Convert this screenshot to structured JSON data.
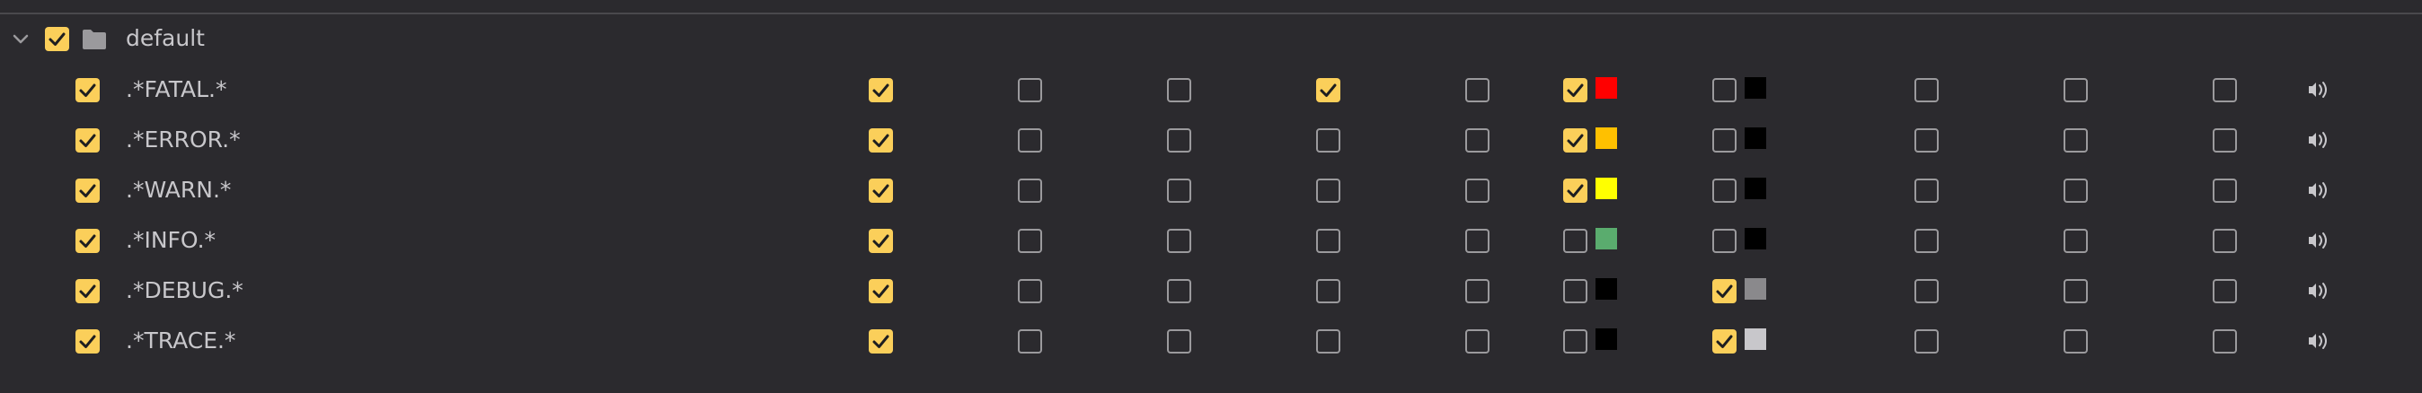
{
  "group": {
    "label": "default",
    "checked": true,
    "expanded": true
  },
  "rows": [
    {
      "label": ".*FATAL.*",
      "enabled": true,
      "checks": [
        true,
        false,
        false,
        true,
        false
      ],
      "fg": {
        "checked": true,
        "color": "#ff0000"
      },
      "bg": {
        "checked": false,
        "color": "#000000"
      },
      "tail": [
        false,
        false,
        false
      ]
    },
    {
      "label": ".*ERROR.*",
      "enabled": true,
      "checks": [
        true,
        false,
        false,
        false,
        false
      ],
      "fg": {
        "checked": true,
        "color": "#ffc000"
      },
      "bg": {
        "checked": false,
        "color": "#000000"
      },
      "tail": [
        false,
        false,
        false
      ]
    },
    {
      "label": ".*WARN.*",
      "enabled": true,
      "checks": [
        true,
        false,
        false,
        false,
        false
      ],
      "fg": {
        "checked": true,
        "color": "#ffff00"
      },
      "bg": {
        "checked": false,
        "color": "#000000"
      },
      "tail": [
        false,
        false,
        false
      ]
    },
    {
      "label": ".*INFO.*",
      "enabled": true,
      "checks": [
        true,
        false,
        false,
        false,
        false
      ],
      "fg": {
        "checked": false,
        "color": "#5aac6e"
      },
      "bg": {
        "checked": false,
        "color": "#000000"
      },
      "tail": [
        false,
        false,
        false
      ]
    },
    {
      "label": ".*DEBUG.*",
      "enabled": true,
      "checks": [
        true,
        false,
        false,
        false,
        false
      ],
      "fg": {
        "checked": false,
        "color": "#000000"
      },
      "bg": {
        "checked": true,
        "color": "#8a898c"
      },
      "tail": [
        false,
        false,
        false
      ]
    },
    {
      "label": ".*TRACE.*",
      "enabled": true,
      "checks": [
        true,
        false,
        false,
        false,
        false
      ],
      "fg": {
        "checked": false,
        "color": "#000000"
      },
      "bg": {
        "checked": true,
        "color": "#c8c7cb"
      },
      "tail": [
        false,
        false,
        false
      ]
    }
  ],
  "icons": {
    "expand": "chevron-down-icon",
    "folder": "folder-icon",
    "sound": "speaker-icon"
  },
  "colors": {
    "background": "#2b2a2e",
    "checkbox_on": "#fbcf5a",
    "checkbox_off_border": "#9b9a9d",
    "text": "#c8c7cb"
  }
}
